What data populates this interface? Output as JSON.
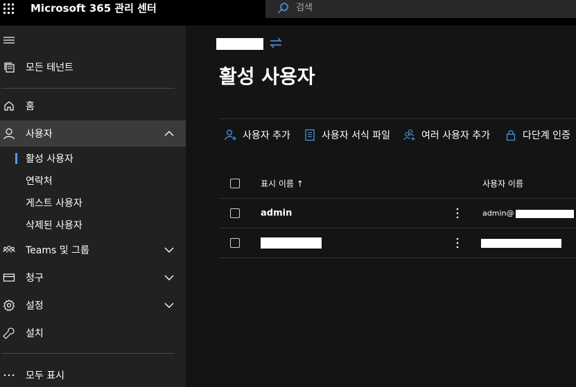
{
  "header": {
    "app_title": "Microsoft 365 관리 센터",
    "search_placeholder": "검색"
  },
  "sidebar": {
    "all_tenants": "모든 테넌트",
    "home": "홈",
    "users": "사용자",
    "users_children": [
      "활성 사용자",
      "연락처",
      "게스트 사용자",
      "삭제된 사용자"
    ],
    "teams_groups": "Teams 및 그룹",
    "billing": "청구",
    "settings": "설정",
    "setup": "설치",
    "show_all": "모두 표시"
  },
  "main": {
    "page_title": "활성 사용자",
    "commands": [
      "사용자 추가",
      "사용자 서식 파일",
      "여러 사용자 추가",
      "다단계 인증"
    ],
    "columns": {
      "display_name": "표시 이름 ↑",
      "username": "사용자 이름"
    },
    "rows": [
      {
        "display_name": "admin",
        "username": "admin@"
      },
      {
        "display_name": "",
        "username": ""
      }
    ]
  },
  "colors": {
    "accent": "#4f9cf0",
    "topbar": "#000000",
    "sidebar": "#212121",
    "main": "#141414"
  }
}
